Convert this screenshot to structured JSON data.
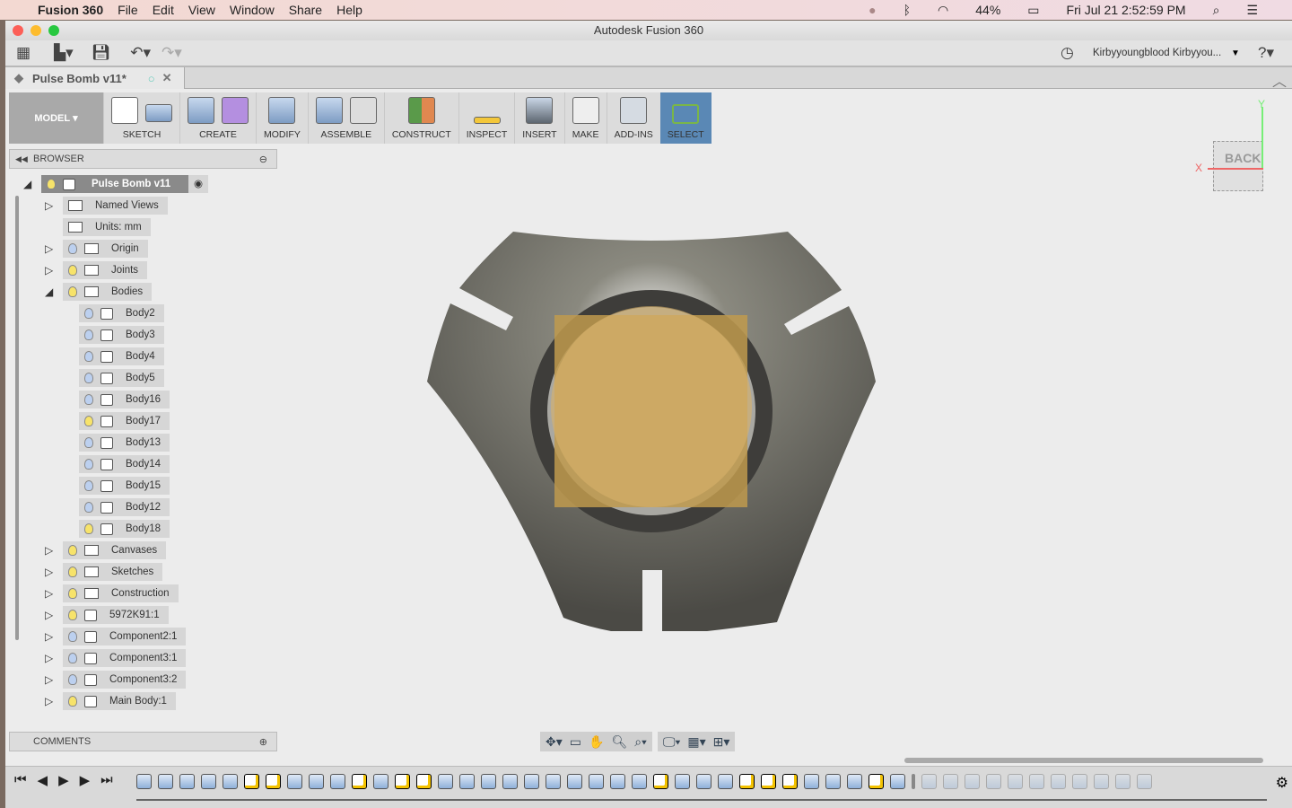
{
  "menubar": {
    "app": "Fusion 360",
    "items": [
      "File",
      "Edit",
      "View",
      "Window",
      "Share",
      "Help"
    ],
    "battery": "44%",
    "clock": "Fri Jul 21  2:52:59 PM"
  },
  "window": {
    "title": "Autodesk Fusion 360",
    "user": "Kirbyyoungblood Kirbyyou...",
    "tab": "Pulse Bomb v11*"
  },
  "ribbon": {
    "workspace": "MODEL",
    "groups": [
      "SKETCH",
      "CREATE",
      "MODIFY",
      "ASSEMBLE",
      "CONSTRUCT",
      "INSPECT",
      "INSERT",
      "MAKE",
      "ADD-INS",
      "SELECT"
    ]
  },
  "browser": {
    "title": "BROWSER",
    "root": "Pulse Bomb v11",
    "items": [
      {
        "label": "Named Views",
        "level": 1,
        "expand": "collapsed",
        "type": "folder"
      },
      {
        "label": "Units: mm",
        "level": 1,
        "type": "units"
      },
      {
        "label": "Origin",
        "level": 1,
        "expand": "collapsed",
        "type": "folder",
        "visible": false
      },
      {
        "label": "Joints",
        "level": 1,
        "expand": "collapsed",
        "type": "folder",
        "visible": true
      },
      {
        "label": "Bodies",
        "level": 1,
        "expand": "expanded",
        "type": "folder",
        "visible": true
      },
      {
        "label": "Body2",
        "level": 2,
        "type": "body",
        "visible": false
      },
      {
        "label": "Body3",
        "level": 2,
        "type": "body",
        "visible": false
      },
      {
        "label": "Body4",
        "level": 2,
        "type": "body",
        "visible": false
      },
      {
        "label": "Body5",
        "level": 2,
        "type": "body",
        "visible": false
      },
      {
        "label": "Body16",
        "level": 2,
        "type": "body",
        "visible": false
      },
      {
        "label": "Body17",
        "level": 2,
        "type": "body",
        "visible": true
      },
      {
        "label": "Body13",
        "level": 2,
        "type": "body",
        "visible": false
      },
      {
        "label": "Body14",
        "level": 2,
        "type": "body",
        "visible": false
      },
      {
        "label": "Body15",
        "level": 2,
        "type": "body",
        "visible": false
      },
      {
        "label": "Body12",
        "level": 2,
        "type": "body",
        "visible": false
      },
      {
        "label": "Body18",
        "level": 2,
        "type": "body",
        "visible": true
      },
      {
        "label": "Canvases",
        "level": 1,
        "expand": "collapsed",
        "type": "folder",
        "visible": true
      },
      {
        "label": "Sketches",
        "level": 1,
        "expand": "collapsed",
        "type": "folder",
        "visible": true
      },
      {
        "label": "Construction",
        "level": 1,
        "expand": "collapsed",
        "type": "folder",
        "visible": true
      },
      {
        "label": "5972K91:1",
        "level": 1,
        "expand": "collapsed",
        "type": "component",
        "visible": true
      },
      {
        "label": "Component2:1",
        "level": 1,
        "expand": "collapsed",
        "type": "component",
        "visible": false
      },
      {
        "label": "Component3:1",
        "level": 1,
        "expand": "collapsed",
        "type": "component",
        "visible": false
      },
      {
        "label": "Component3:2",
        "level": 1,
        "expand": "collapsed",
        "type": "component",
        "visible": false
      },
      {
        "label": "Main Body:1",
        "level": 1,
        "expand": "collapsed",
        "type": "component",
        "visible": true
      }
    ]
  },
  "comments": {
    "title": "COMMENTS"
  },
  "viewcube": {
    "face": "BACK",
    "x": "X",
    "y": "Y"
  },
  "timeline": {
    "features": [
      "extrude",
      "extrude",
      "extrude",
      "fillet",
      "chamfer",
      "sketch",
      "sketch",
      "revolve",
      "revolve",
      "shell",
      "sketch",
      "revolve",
      "sketch",
      "sketch",
      "revolve",
      "revolve",
      "combine",
      "move",
      "revolve",
      "align",
      "align",
      "combine",
      "chamfer",
      "fillet",
      "sketch",
      "extrude",
      "combine",
      "move",
      "sketch",
      "sketch",
      "sketch",
      "chamfer",
      "shell",
      "split",
      "sketch",
      "split"
    ],
    "future": [
      "split",
      "move",
      "combine",
      "split",
      "sketch",
      "extrude",
      "sketch",
      "extrude",
      "combine",
      "canvas",
      "move"
    ]
  },
  "colors": {
    "accent": "#5a88b5",
    "model_body": "#6e6d66",
    "gold_body": "#c09a4e"
  }
}
